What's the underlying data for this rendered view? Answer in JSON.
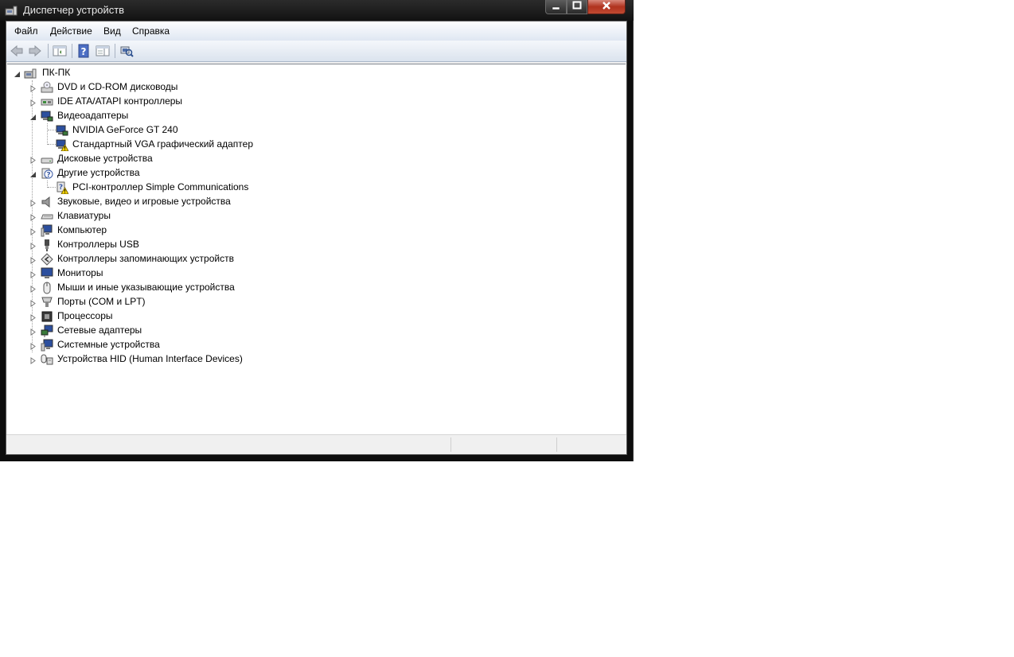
{
  "window": {
    "title": "Диспетчер устройств"
  },
  "menu": {
    "items": [
      "Файл",
      "Действие",
      "Вид",
      "Справка"
    ]
  },
  "toolbar": {
    "buttons": [
      "back-arrow-icon",
      "forward-arrow-icon",
      "properties-pane-icon",
      "help-icon",
      "console-tree-icon",
      "scan-hardware-icon"
    ]
  },
  "tree": {
    "root": "ПК-ПК",
    "nodes": [
      {
        "label": "DVD и CD-ROM дисководы",
        "icon": "dvd-drive-icon",
        "expanded": false,
        "children": []
      },
      {
        "label": "IDE ATA/ATAPI контроллеры",
        "icon": "ide-controller-icon",
        "expanded": false,
        "children": []
      },
      {
        "label": "Видеоадаптеры",
        "icon": "display-adapter-icon",
        "expanded": true,
        "children": [
          {
            "label": "NVIDIA GeForce GT 240",
            "icon": "display-adapter-icon",
            "warning": false
          },
          {
            "label": "Стандартный VGA графический адаптер",
            "icon": "display-adapter-warning-icon",
            "warning": true
          }
        ]
      },
      {
        "label": "Дисковые устройства",
        "icon": "disk-drive-icon",
        "expanded": false,
        "children": []
      },
      {
        "label": "Другие устройства",
        "icon": "unknown-device-icon",
        "expanded": true,
        "children": [
          {
            "label": "PCI-контроллер Simple Communications",
            "icon": "unknown-device-warning-icon",
            "warning": true
          }
        ]
      },
      {
        "label": "Звуковые, видео и игровые устройства",
        "icon": "speaker-icon",
        "expanded": false,
        "children": []
      },
      {
        "label": "Клавиатуры",
        "icon": "keyboard-icon",
        "expanded": false,
        "children": []
      },
      {
        "label": "Компьютер",
        "icon": "computer-icon",
        "expanded": false,
        "children": []
      },
      {
        "label": "Контроллеры USB",
        "icon": "usb-icon",
        "expanded": false,
        "children": []
      },
      {
        "label": "Контроллеры запоминающих устройств",
        "icon": "storage-controller-icon",
        "expanded": false,
        "children": []
      },
      {
        "label": "Мониторы",
        "icon": "monitor-icon",
        "expanded": false,
        "children": []
      },
      {
        "label": "Мыши и иные указывающие устройства",
        "icon": "mouse-icon",
        "expanded": false,
        "children": []
      },
      {
        "label": "Порты (COM и LPT)",
        "icon": "port-icon",
        "expanded": false,
        "children": []
      },
      {
        "label": "Процессоры",
        "icon": "processor-icon",
        "expanded": false,
        "children": []
      },
      {
        "label": "Сетевые адаптеры",
        "icon": "network-adapter-icon",
        "expanded": false,
        "children": []
      },
      {
        "label": "Системные устройства",
        "icon": "system-device-icon",
        "expanded": false,
        "children": []
      },
      {
        "label": "Устройства HID (Human Interface Devices)",
        "icon": "hid-icon",
        "expanded": false,
        "children": []
      }
    ]
  }
}
